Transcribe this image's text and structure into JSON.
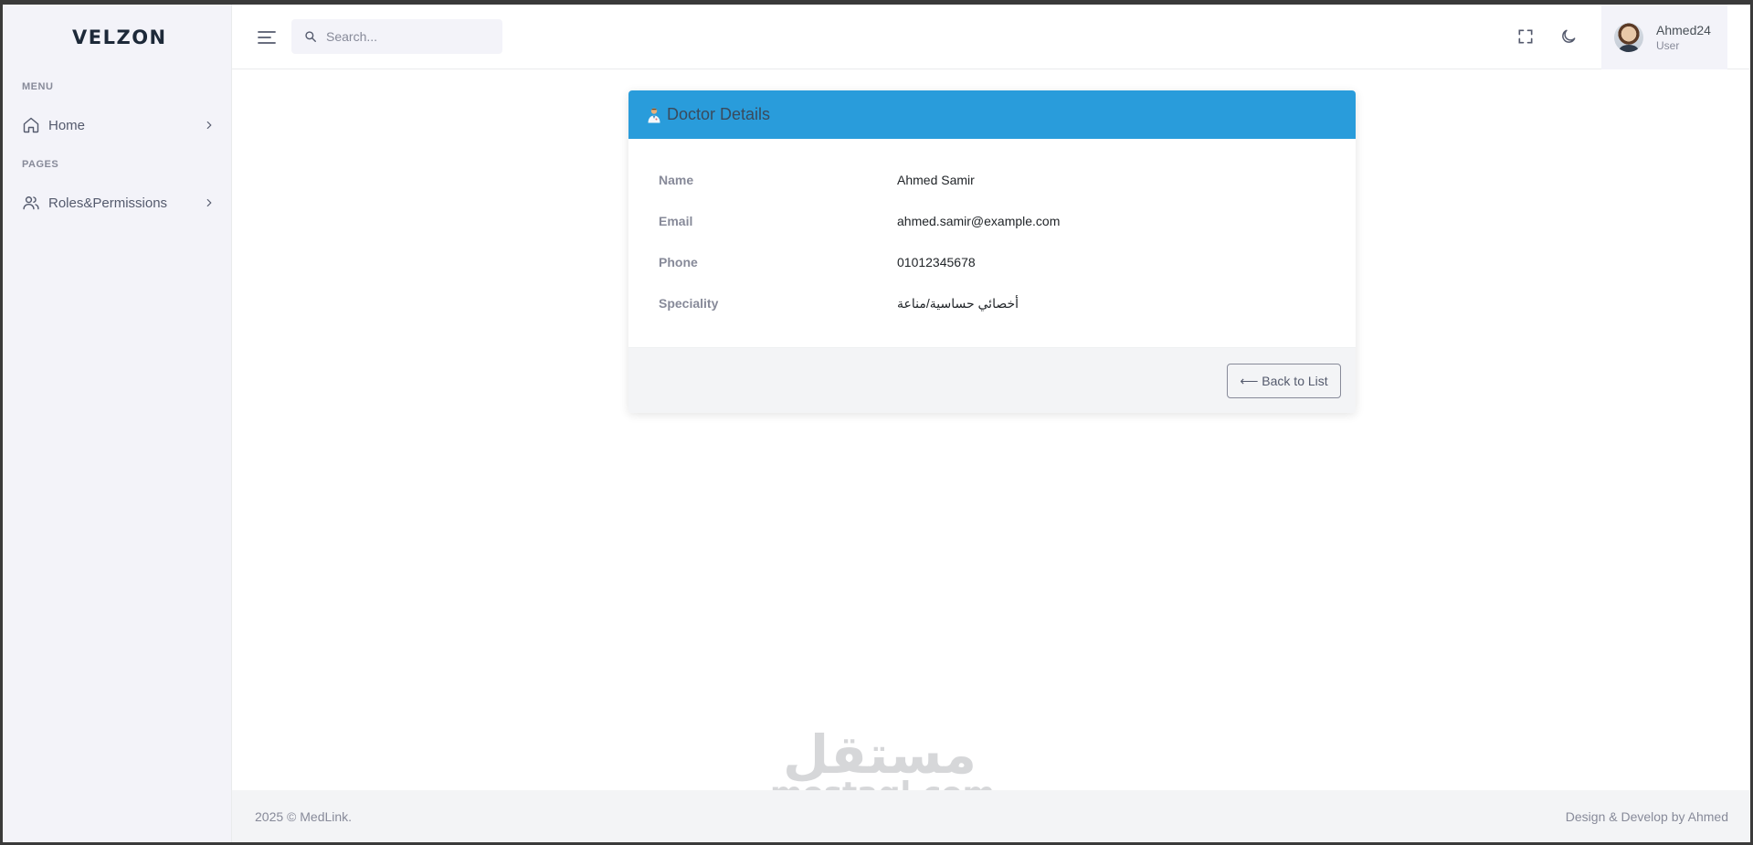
{
  "sidebar": {
    "logo": "VELZON",
    "menu_title": "MENU",
    "pages_title": "PAGES",
    "items": [
      {
        "label": "Home",
        "icon": "home-icon"
      },
      {
        "label": "Roles&Permissions",
        "icon": "users-icon"
      }
    ]
  },
  "header": {
    "search_placeholder": "Search...",
    "user": {
      "name": "Ahmed24",
      "role": "User"
    }
  },
  "card": {
    "title": "Doctor Details",
    "fields": [
      {
        "label": "Name",
        "value": "Ahmed Samir"
      },
      {
        "label": "Email",
        "value": "ahmed.samir@example.com"
      },
      {
        "label": "Phone",
        "value": "01012345678"
      },
      {
        "label": "Speciality",
        "value": "أخصائي حساسية/مناعة"
      }
    ],
    "back_label": "⟵ Back to List"
  },
  "footer": {
    "left": "2025 © MedLink.",
    "right": "Design & Develop by Ahmed"
  },
  "watermark": {
    "arabic": "مستقل",
    "latin": "mostaql.com"
  },
  "colors": {
    "accent": "#299cdb",
    "sidebar_bg": "#f3f3f9",
    "muted": "#878a99"
  }
}
